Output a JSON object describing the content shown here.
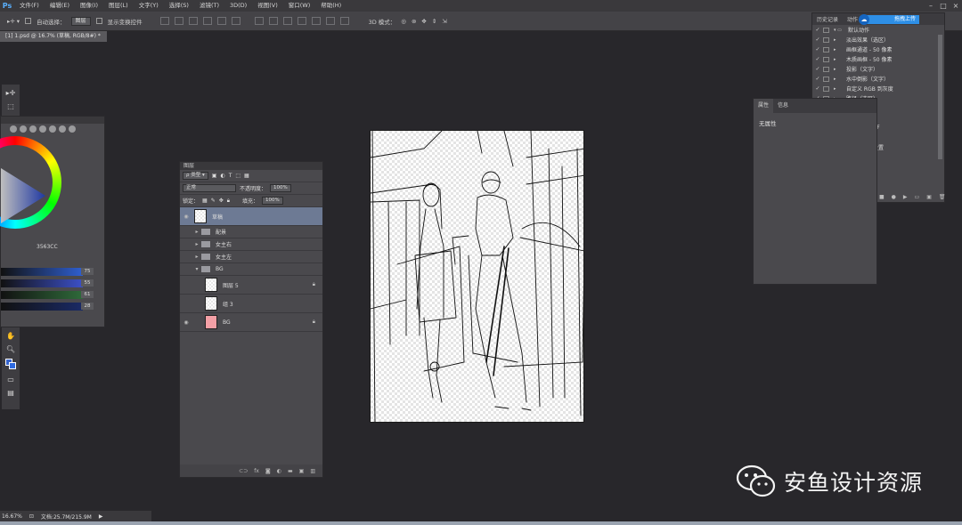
{
  "app": {
    "logo": "Ps",
    "menus": [
      "文件(F)",
      "编辑(E)",
      "图像(I)",
      "图层(L)",
      "文字(Y)",
      "选择(S)",
      "滤镜(T)",
      "3D(D)",
      "视图(V)",
      "窗口(W)",
      "帮助(H)"
    ]
  },
  "options_bar": {
    "auto_select_label": "自动选择：",
    "auto_select_value": "图层",
    "show_transform_label": "显示变换控件",
    "mode_3d_label": "3D 模式："
  },
  "document": {
    "tab_title": "[1] 1.psd @ 16.7% (草稿, RGB/8#) *"
  },
  "color_panel": {
    "hex": "3563CC",
    "sliders": [
      {
        "value": "75",
        "color": "#2f5fd0"
      },
      {
        "value": "55",
        "color": "#3c50c8"
      },
      {
        "value": "61",
        "color": "#2f6a3a"
      },
      {
        "value": "28",
        "color": "#1a2a66"
      }
    ]
  },
  "layers_panel": {
    "title": "图层",
    "filter_label": "类型",
    "blend_mode": "正常",
    "opacity_label": "不透明度：",
    "opacity_value": "100%",
    "lock_label": "锁定：",
    "fill_label": "填充：",
    "fill_value": "100%",
    "layers": [
      {
        "name": "草稿",
        "kind": "layer",
        "selected": true
      },
      {
        "name": "配景",
        "kind": "group"
      },
      {
        "name": "女主右",
        "kind": "group"
      },
      {
        "name": "女主左",
        "kind": "group"
      },
      {
        "name": "BG",
        "kind": "group-open"
      },
      {
        "name": "图层 5",
        "kind": "layer-locked"
      },
      {
        "name": "组 3",
        "kind": "layer"
      },
      {
        "name": "BG",
        "kind": "layer-bg"
      }
    ],
    "bottom_icons": [
      "link-icon",
      "fx-icon",
      "mask-icon",
      "adjust-icon",
      "folder-icon",
      "new-layer-icon",
      "trash-icon"
    ]
  },
  "properties_panel": {
    "tabs": [
      "属性",
      "信息"
    ],
    "body": "无属性"
  },
  "actions_panel": {
    "tabs": [
      "历史记录",
      "动作"
    ],
    "cloud_button": "拖拽上传",
    "items": [
      {
        "label": "默认动作",
        "level": 0
      },
      {
        "label": "淡出效果（选区）",
        "level": 1
      },
      {
        "label": "画框通道 - 50 像素",
        "level": 1
      },
      {
        "label": "木质画框 - 50 像素",
        "level": 1
      },
      {
        "label": "投影（文字）",
        "level": 1
      },
      {
        "label": "水中倒影（文字）",
        "level": 1
      },
      {
        "label": "自定义 RGB 到灰度",
        "level": 1
      },
      {
        "label": "路径（选区）",
        "level": 1
      },
      {
        "label": "（图层）",
        "level": 1
      },
      {
        "label": "",
        "level": 1
      },
      {
        "label": "otoshop PDF",
        "level": 1
      },
      {
        "label": "",
        "level": 1
      },
      {
        "label": "充和描边面设置",
        "level": 1
      }
    ]
  },
  "status_bar": {
    "zoom": "16.67%",
    "doc_info": "文档:25.7M/215.9M"
  },
  "watermark": {
    "text": "安鱼设计资源"
  },
  "colors": {
    "app_bg": "#28272b",
    "panel": "#4a494d",
    "selected_layer": "#6d7a94",
    "cloud_blue": "#2e8fe6",
    "bg_layer_pink": "#f4a0a6"
  }
}
